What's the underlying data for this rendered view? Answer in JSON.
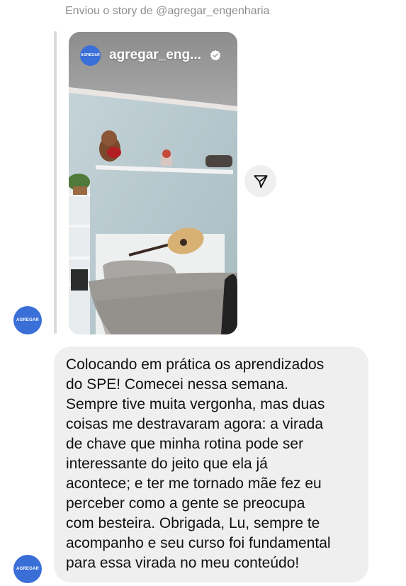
{
  "story": {
    "caption": "Enviou o story de @agregar_engenharia",
    "username": "agregar_eng...",
    "avatar_text": "AGREGAR",
    "verified": true
  },
  "share": {
    "icon": "send-icon"
  },
  "message": {
    "sender_avatar_text": "AGREGAR",
    "text": "Colocando em prática os aprendizados\ndo SPE! Comecei nessa semana.\nSempre tive muita vergonha, mas duas\ncoisas me destravaram agora: a virada\nde chave que minha rotina pode ser\ninteressante do jeito que ela já\nacontece; e ter me tornado mãe fez eu\nperceber como a gente se preocupa\ncom besteira. Obrigada, Lu, sempre te\nacompanho e seu curso foi fundamental\npara essa virada no meu conteúdo!"
  },
  "colors": {
    "accent": "#3a6fd8",
    "bubble": "#efefef",
    "caption": "#8e8e8e"
  }
}
